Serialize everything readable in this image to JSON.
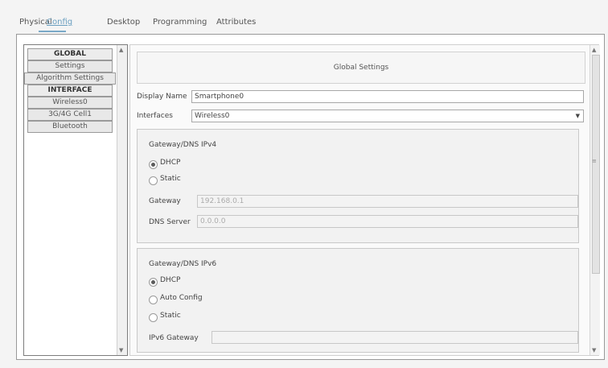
{
  "tabs": [
    "Physical",
    "Config",
    "Desktop",
    "Programming",
    "Attributes"
  ],
  "left_nav": {
    "items": [
      {
        "label": "GLOBAL",
        "type": "header"
      },
      {
        "label": "Settings",
        "type": "item"
      },
      {
        "label": "Algorithm Settings",
        "type": "item"
      },
      {
        "label": "INTERFACE",
        "type": "header"
      },
      {
        "label": "Wireless0",
        "type": "item"
      },
      {
        "label": "3G/4G Cell1",
        "type": "item"
      },
      {
        "label": "Bluetooth",
        "type": "item"
      }
    ]
  },
  "settings": {
    "title": "Global Settings",
    "display_name_label": "Display Name",
    "display_name_value": "Smartphone0",
    "interfaces_label": "Interfaces",
    "interfaces_value": "Wireless0"
  },
  "ipv4": {
    "title": "Gateway/DNS IPv4",
    "dhcp_label": "DHCP",
    "static_label": "Static",
    "gateway_label": "Gateway",
    "gateway_value": "192.168.0.1",
    "dns_label": "DNS Server",
    "dns_value": "0.0.0.0"
  },
  "ipv6": {
    "title": "Gateway/DNS IPv6",
    "dhcp_label": "DHCP",
    "auto_label": "Auto Config",
    "static_label": "Static",
    "gateway_label": "IPv6 Gateway",
    "gateway_value": ""
  }
}
